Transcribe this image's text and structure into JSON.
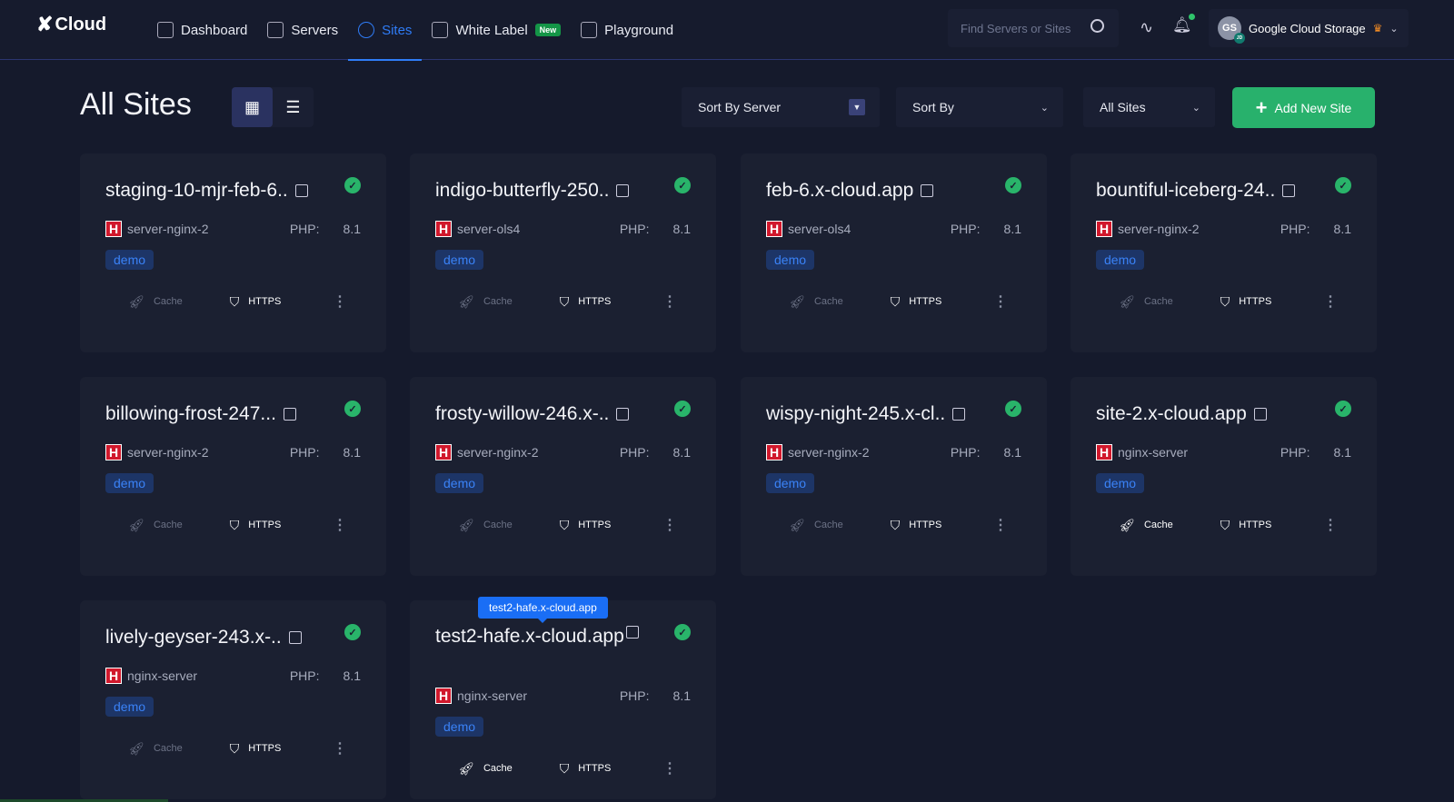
{
  "nav": {
    "logo": "Cloud",
    "items": [
      {
        "label": "Dashboard"
      },
      {
        "label": "Servers"
      },
      {
        "label": "Sites"
      },
      {
        "label": "White Label",
        "badge": "New"
      },
      {
        "label": "Playground"
      }
    ],
    "search_placeholder": "Find Servers or Sites",
    "user": {
      "initials": "GS",
      "sub_initials": "JD",
      "name": "Google Cloud Storage"
    }
  },
  "page": {
    "title": "All Sites",
    "sort_server": "Sort By Server",
    "sort_by": "Sort By",
    "filter": "All Sites",
    "add_button": "Add New Site"
  },
  "labels": {
    "php": "PHP:",
    "cache": "Cache",
    "https": "HTTPS"
  },
  "tooltip": "test2-hafe.x-cloud.app",
  "sites": [
    {
      "name": "staging-10-mjr-feb-6..",
      "server": "server-nginx-2",
      "php": "8.1",
      "tag": "demo",
      "cache_on": false
    },
    {
      "name": "indigo-butterfly-250..",
      "server": "server-ols4",
      "php": "8.1",
      "tag": "demo",
      "cache_on": false
    },
    {
      "name": "feb-6.x-cloud.app",
      "server": "server-ols4",
      "php": "8.1",
      "tag": "demo",
      "cache_on": false
    },
    {
      "name": "bountiful-iceberg-24..",
      "server": "server-nginx-2",
      "php": "8.1",
      "tag": "demo",
      "cache_on": false
    },
    {
      "name": "billowing-frost-247...",
      "server": "server-nginx-2",
      "php": "8.1",
      "tag": "demo",
      "cache_on": false
    },
    {
      "name": "frosty-willow-246.x-..",
      "server": "server-nginx-2",
      "php": "8.1",
      "tag": "demo",
      "cache_on": false
    },
    {
      "name": "wispy-night-245.x-cl..",
      "server": "server-nginx-2",
      "php": "8.1",
      "tag": "demo",
      "cache_on": false
    },
    {
      "name": "site-2.x-cloud.app",
      "server": "nginx-server",
      "php": "8.1",
      "tag": "demo",
      "cache_on": true
    },
    {
      "name": "lively-geyser-243.x-..",
      "server": "nginx-server",
      "php": "8.1",
      "tag": "demo",
      "cache_on": false
    },
    {
      "name": "test2-hafe.x-cloud.app",
      "server": "nginx-server",
      "php": "8.1",
      "tag": "demo",
      "cache_on": true
    }
  ]
}
